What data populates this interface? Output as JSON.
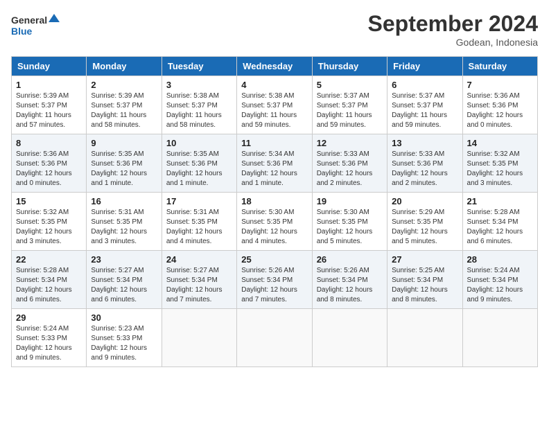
{
  "header": {
    "logo_line1": "General",
    "logo_line2": "Blue",
    "month": "September 2024",
    "location": "Godean, Indonesia"
  },
  "weekdays": [
    "Sunday",
    "Monday",
    "Tuesday",
    "Wednesday",
    "Thursday",
    "Friday",
    "Saturday"
  ],
  "weeks": [
    [
      {
        "day": "1",
        "sunrise": "5:39 AM",
        "sunset": "5:37 PM",
        "daylight": "11 hours and 57 minutes."
      },
      {
        "day": "2",
        "sunrise": "5:39 AM",
        "sunset": "5:37 PM",
        "daylight": "11 hours and 58 minutes."
      },
      {
        "day": "3",
        "sunrise": "5:38 AM",
        "sunset": "5:37 PM",
        "daylight": "11 hours and 58 minutes."
      },
      {
        "day": "4",
        "sunrise": "5:38 AM",
        "sunset": "5:37 PM",
        "daylight": "11 hours and 59 minutes."
      },
      {
        "day": "5",
        "sunrise": "5:37 AM",
        "sunset": "5:37 PM",
        "daylight": "11 hours and 59 minutes."
      },
      {
        "day": "6",
        "sunrise": "5:37 AM",
        "sunset": "5:37 PM",
        "daylight": "11 hours and 59 minutes."
      },
      {
        "day": "7",
        "sunrise": "5:36 AM",
        "sunset": "5:36 PM",
        "daylight": "12 hours and 0 minutes."
      }
    ],
    [
      {
        "day": "8",
        "sunrise": "5:36 AM",
        "sunset": "5:36 PM",
        "daylight": "12 hours and 0 minutes."
      },
      {
        "day": "9",
        "sunrise": "5:35 AM",
        "sunset": "5:36 PM",
        "daylight": "12 hours and 1 minute."
      },
      {
        "day": "10",
        "sunrise": "5:35 AM",
        "sunset": "5:36 PM",
        "daylight": "12 hours and 1 minute."
      },
      {
        "day": "11",
        "sunrise": "5:34 AM",
        "sunset": "5:36 PM",
        "daylight": "12 hours and 1 minute."
      },
      {
        "day": "12",
        "sunrise": "5:33 AM",
        "sunset": "5:36 PM",
        "daylight": "12 hours and 2 minutes."
      },
      {
        "day": "13",
        "sunrise": "5:33 AM",
        "sunset": "5:36 PM",
        "daylight": "12 hours and 2 minutes."
      },
      {
        "day": "14",
        "sunrise": "5:32 AM",
        "sunset": "5:35 PM",
        "daylight": "12 hours and 3 minutes."
      }
    ],
    [
      {
        "day": "15",
        "sunrise": "5:32 AM",
        "sunset": "5:35 PM",
        "daylight": "12 hours and 3 minutes."
      },
      {
        "day": "16",
        "sunrise": "5:31 AM",
        "sunset": "5:35 PM",
        "daylight": "12 hours and 3 minutes."
      },
      {
        "day": "17",
        "sunrise": "5:31 AM",
        "sunset": "5:35 PM",
        "daylight": "12 hours and 4 minutes."
      },
      {
        "day": "18",
        "sunrise": "5:30 AM",
        "sunset": "5:35 PM",
        "daylight": "12 hours and 4 minutes."
      },
      {
        "day": "19",
        "sunrise": "5:30 AM",
        "sunset": "5:35 PM",
        "daylight": "12 hours and 5 minutes."
      },
      {
        "day": "20",
        "sunrise": "5:29 AM",
        "sunset": "5:35 PM",
        "daylight": "12 hours and 5 minutes."
      },
      {
        "day": "21",
        "sunrise": "5:28 AM",
        "sunset": "5:34 PM",
        "daylight": "12 hours and 6 minutes."
      }
    ],
    [
      {
        "day": "22",
        "sunrise": "5:28 AM",
        "sunset": "5:34 PM",
        "daylight": "12 hours and 6 minutes."
      },
      {
        "day": "23",
        "sunrise": "5:27 AM",
        "sunset": "5:34 PM",
        "daylight": "12 hours and 6 minutes."
      },
      {
        "day": "24",
        "sunrise": "5:27 AM",
        "sunset": "5:34 PM",
        "daylight": "12 hours and 7 minutes."
      },
      {
        "day": "25",
        "sunrise": "5:26 AM",
        "sunset": "5:34 PM",
        "daylight": "12 hours and 7 minutes."
      },
      {
        "day": "26",
        "sunrise": "5:26 AM",
        "sunset": "5:34 PM",
        "daylight": "12 hours and 8 minutes."
      },
      {
        "day": "27",
        "sunrise": "5:25 AM",
        "sunset": "5:34 PM",
        "daylight": "12 hours and 8 minutes."
      },
      {
        "day": "28",
        "sunrise": "5:24 AM",
        "sunset": "5:34 PM",
        "daylight": "12 hours and 9 minutes."
      }
    ],
    [
      {
        "day": "29",
        "sunrise": "5:24 AM",
        "sunset": "5:33 PM",
        "daylight": "12 hours and 9 minutes."
      },
      {
        "day": "30",
        "sunrise": "5:23 AM",
        "sunset": "5:33 PM",
        "daylight": "12 hours and 9 minutes."
      },
      null,
      null,
      null,
      null,
      null
    ]
  ]
}
